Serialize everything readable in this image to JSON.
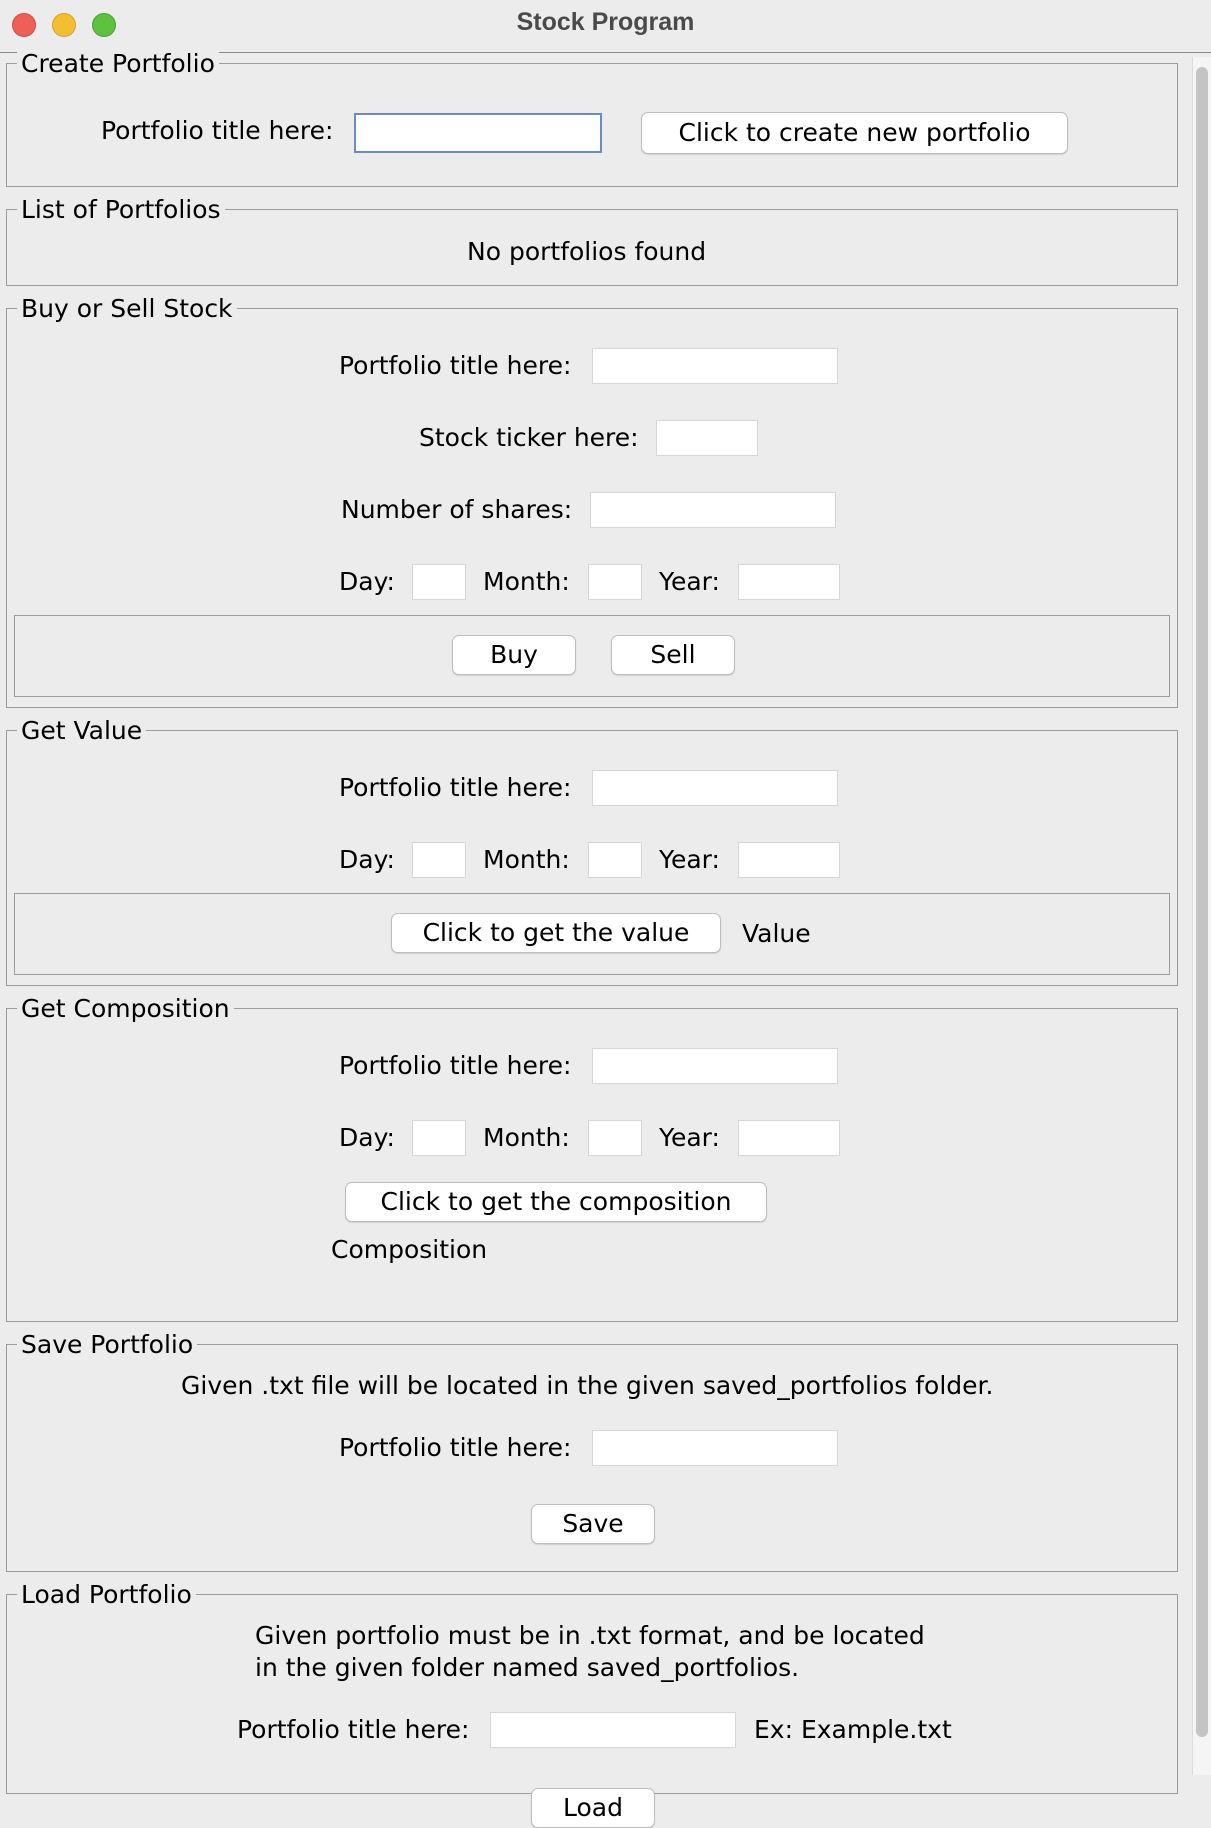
{
  "window": {
    "title": "Stock Program"
  },
  "create": {
    "legend": "Create Portfolio",
    "title_label": "Portfolio title here:",
    "title_value": "",
    "create_button": "Click to create new portfolio"
  },
  "list": {
    "legend": "List of Portfolios",
    "empty_text": "No portfolios found"
  },
  "trade": {
    "legend": "Buy or Sell Stock",
    "title_label": "Portfolio title here:",
    "ticker_label": "Stock ticker here:",
    "shares_label": "Number of shares:",
    "day_label": "Day:",
    "month_label": "Month:",
    "year_label": "Year:",
    "buy_button": "Buy",
    "sell_button": "Sell"
  },
  "value": {
    "legend": "Get Value",
    "title_label": "Portfolio title here:",
    "day_label": "Day:",
    "month_label": "Month:",
    "year_label": "Year:",
    "get_button": "Click to get the value",
    "result_text": "Value"
  },
  "composition": {
    "legend": "Get Composition",
    "title_label": "Portfolio title here:",
    "day_label": "Day:",
    "month_label": "Month:",
    "year_label": "Year:",
    "get_button": "Click to get the composition",
    "result_text": "Composition"
  },
  "save": {
    "legend": "Save Portfolio",
    "info_text": "Given .txt file will be located in the given saved_portfolios folder.",
    "title_label": "Portfolio title here:",
    "save_button": "Save"
  },
  "load": {
    "legend": "Load Portfolio",
    "info_line1": "Given portfolio must be in .txt format, and be located",
    "info_line2": "in the given folder named saved_portfolios.",
    "title_label": "Portfolio title here:",
    "example_text": "Ex: Example.txt",
    "load_button": "Load"
  }
}
